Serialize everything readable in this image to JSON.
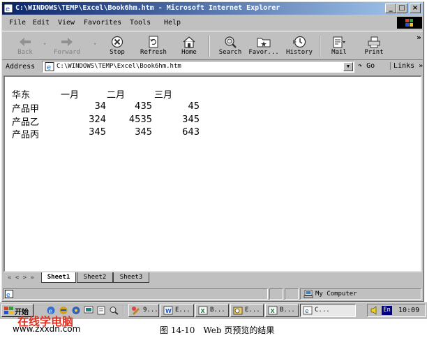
{
  "window": {
    "title": "C:\\WINDOWS\\TEMP\\Excel\\Book6hm.htm - Microsoft Internet Explorer",
    "minimize": "_",
    "maximize": "□",
    "close": "×"
  },
  "menu": [
    "File",
    "Edit",
    "View",
    "Favorites",
    "Tools",
    "Help"
  ],
  "toolbar": {
    "back": "Back",
    "forward": "Forward",
    "stop": "Stop",
    "refresh": "Refresh",
    "home": "Home",
    "search": "Search",
    "favorites": "Favor...",
    "history": "History",
    "mail": "Mail",
    "print": "Print",
    "more": "»"
  },
  "address": {
    "label": "Address",
    "url": "C:\\WINDOWS\\TEMP\\Excel\\Book6hm.htm",
    "go": "Go",
    "links": "Links »"
  },
  "sheet": {
    "header": [
      "华东",
      "一月",
      "二月",
      "三月"
    ],
    "rows": [
      [
        "产品甲",
        "34",
        "435",
        "45"
      ],
      [
        "产品乙",
        "324",
        "4535",
        "345"
      ],
      [
        "产品丙",
        "345",
        "345",
        "643"
      ]
    ]
  },
  "tabs": {
    "nav": "« < > »",
    "items": [
      "Sheet1",
      "Sheet2",
      "Sheet3"
    ],
    "active": "Sheet1"
  },
  "status": {
    "zone": "My Computer"
  },
  "taskbar": {
    "start": "开始",
    "tasks": [
      "9...",
      "E...",
      "B...",
      "E...",
      "B...",
      "C..."
    ],
    "lang": "En",
    "clock": "10:09"
  },
  "watermark": {
    "line1": "在线学电脑",
    "line2": "www.zxxdn.com"
  },
  "caption": "图 14-10　Web 页预览的结果"
}
